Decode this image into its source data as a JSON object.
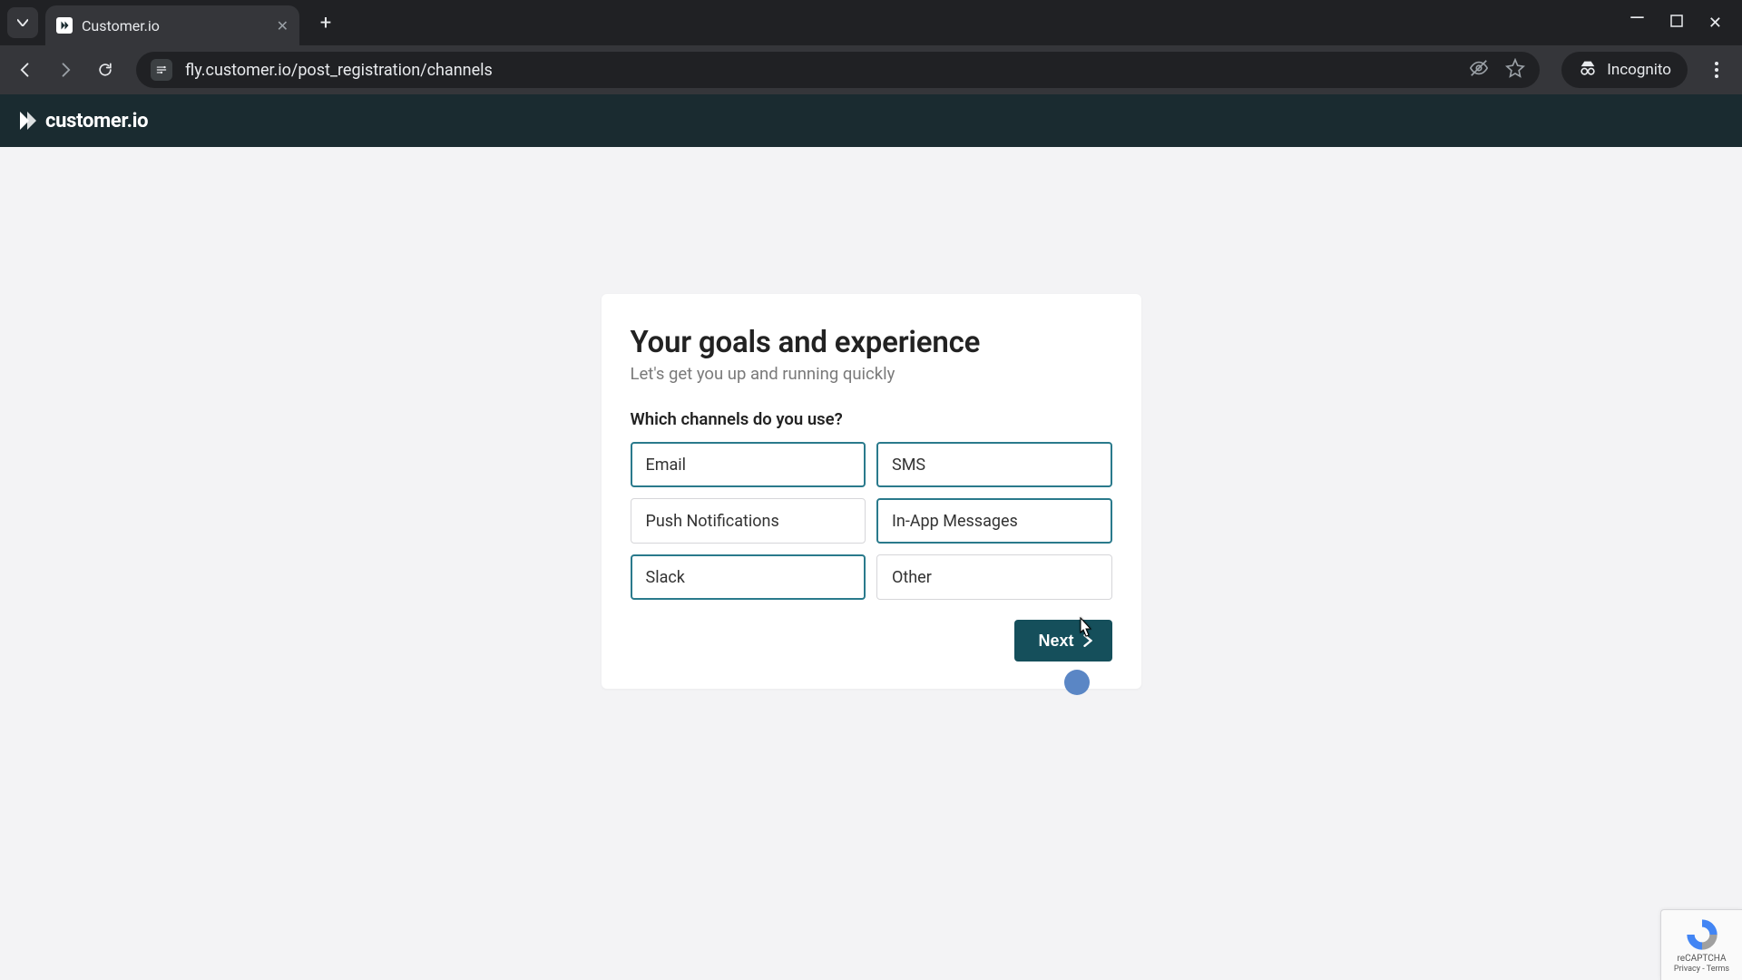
{
  "browser": {
    "tab_title": "Customer.io",
    "url": "fly.customer.io/post_registration/channels",
    "incognito_label": "Incognito"
  },
  "brand": {
    "name": "customer.io"
  },
  "card": {
    "title": "Your goals and experience",
    "subtitle": "Let's get you up and running quickly",
    "question": "Which channels do you use?",
    "options": [
      {
        "label": "Email",
        "selected": true
      },
      {
        "label": "SMS",
        "selected": true
      },
      {
        "label": "Push Notifications",
        "selected": false
      },
      {
        "label": "In-App Messages",
        "selected": true
      },
      {
        "label": "Slack",
        "selected": true
      },
      {
        "label": "Other",
        "selected": false
      }
    ],
    "next_label": "Next"
  },
  "recaptcha": {
    "brand": "reCAPTCHA",
    "links": "Privacy - Terms"
  }
}
